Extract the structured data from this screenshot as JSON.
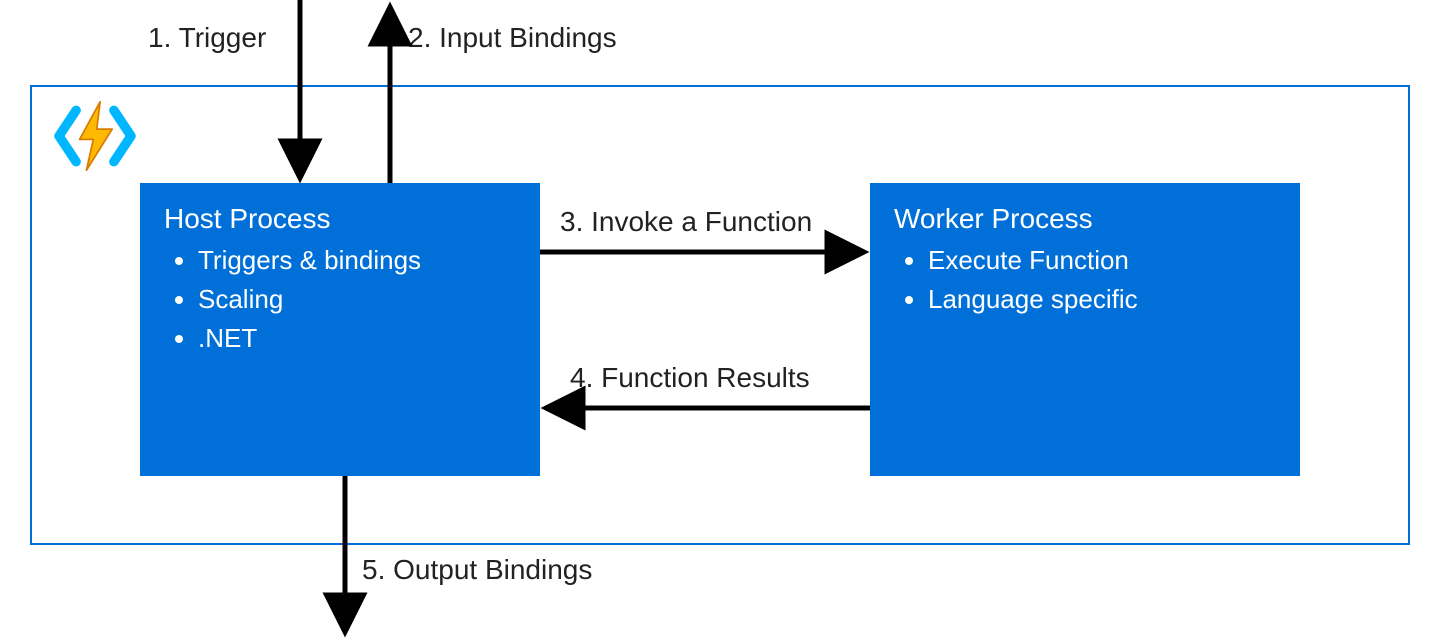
{
  "colors": {
    "accent": "#0070d8",
    "bolt_fill": "#ffb900",
    "bolt_stroke": "#d97a00",
    "bracket": "#00b7ff",
    "arrow": "#000000"
  },
  "labels": {
    "trigger": "1. Trigger",
    "input_bindings": "2. Input Bindings",
    "invoke": "3. Invoke a Function",
    "results": "4. Function Results",
    "output_bindings": "5. Output Bindings"
  },
  "host": {
    "title": "Host Process",
    "items": [
      "Triggers & bindings",
      "Scaling",
      ".NET"
    ]
  },
  "worker": {
    "title": "Worker Process",
    "items": [
      "Execute Function",
      "Language specific"
    ]
  },
  "icon": {
    "name": "azure-functions-icon"
  }
}
